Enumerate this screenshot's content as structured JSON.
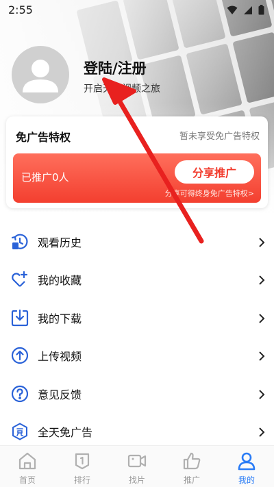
{
  "status_bar": {
    "time": "2:55",
    "icons": [
      "wifi-icon",
      "signal-icon",
      "battery-icon"
    ]
  },
  "profile": {
    "login_title": "登陆/注册",
    "login_subtitle": "开启天狼视频之旅"
  },
  "ad_card": {
    "title": "免广告特权",
    "status": "暂未享受免广告特权",
    "promoted_count": "已推广0人",
    "share_button": "分享推广",
    "hint": "分享可得终身免广告特权>"
  },
  "menu": {
    "items": [
      {
        "label": "观看历史",
        "icon": "history-icon"
      },
      {
        "label": "我的收藏",
        "icon": "heart-plus-icon"
      },
      {
        "label": "我的下载",
        "icon": "download-icon"
      },
      {
        "label": "上传视频",
        "icon": "upload-icon"
      },
      {
        "label": "意见反馈",
        "icon": "question-icon"
      },
      {
        "label": "全天免广告",
        "icon": "ad-free-icon"
      }
    ]
  },
  "bottom_nav": {
    "items": [
      {
        "label": "首页",
        "icon": "home-icon"
      },
      {
        "label": "排行",
        "icon": "ranking-icon"
      },
      {
        "label": "找片",
        "icon": "video-camera-icon"
      },
      {
        "label": "推广",
        "icon": "thumbs-up-icon"
      },
      {
        "label": "我的",
        "icon": "person-icon"
      }
    ],
    "active_index": 4
  },
  "colors": {
    "accent_blue": "#2a7cf6",
    "promo_red": "#f33f2f",
    "annotation_red": "#e8211f"
  }
}
